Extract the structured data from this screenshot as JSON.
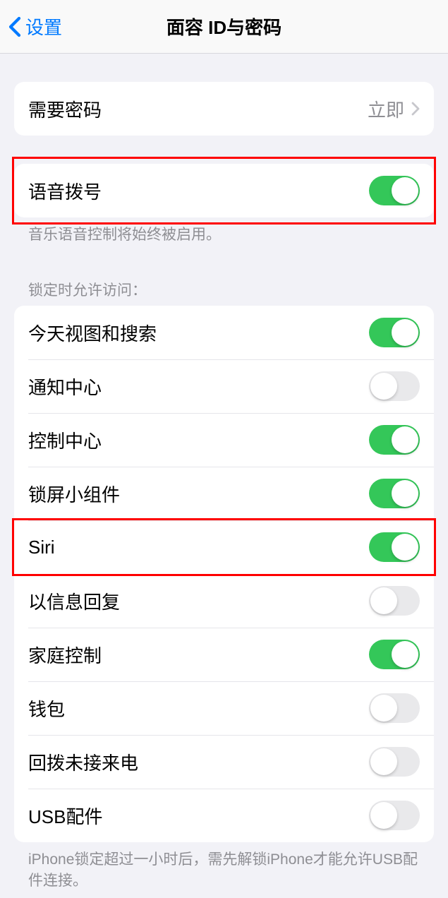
{
  "navbar": {
    "back_label": "设置",
    "title": "面容 ID与密码"
  },
  "passcode_row": {
    "label": "需要密码",
    "value": "立即"
  },
  "voice_dial": {
    "label": "语音拨号",
    "on": true,
    "footer": "音乐语音控制将始终被启用。"
  },
  "lock_header": "锁定时允许访问：",
  "lock_items": [
    {
      "label": "今天视图和搜索",
      "on": true
    },
    {
      "label": "通知中心",
      "on": false
    },
    {
      "label": "控制中心",
      "on": true
    },
    {
      "label": "锁屏小组件",
      "on": true
    },
    {
      "label": "Siri",
      "on": true
    },
    {
      "label": "以信息回复",
      "on": false
    },
    {
      "label": "家庭控制",
      "on": true
    },
    {
      "label": "钱包",
      "on": false
    },
    {
      "label": "回拨未接来电",
      "on": false
    },
    {
      "label": "USB配件",
      "on": false
    }
  ],
  "usb_footer": "iPhone锁定超过一小时后，需先解锁iPhone才能允许USB配件连接。"
}
